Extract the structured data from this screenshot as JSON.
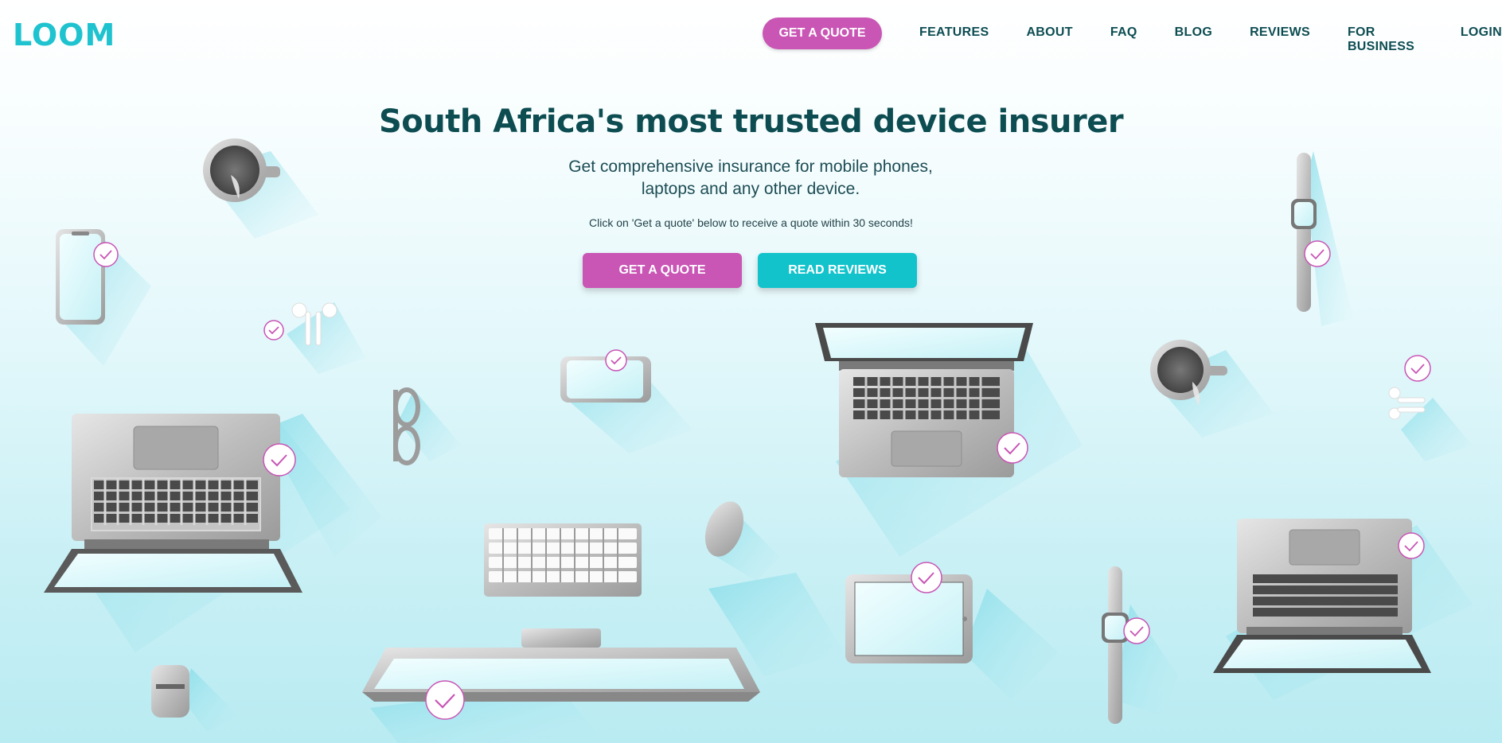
{
  "header": {
    "logo": "LOOM",
    "cta_label": "GET A QUOTE",
    "nav": [
      "FEATURES",
      "ABOUT",
      "FAQ",
      "BLOG",
      "REVIEWS",
      "FOR BUSINESS",
      "LOGIN"
    ]
  },
  "hero": {
    "title": "South Africa's most trusted device insurer",
    "subtitle_line1": "Get comprehensive insurance for mobile phones,",
    "subtitle_line2": "laptops and any other device.",
    "note": "Click on 'Get a quote' below to receive a quote within 30 seconds!",
    "primary_button": "GET A QUOTE",
    "secondary_button": "READ REVIEWS"
  },
  "colors": {
    "brand_teal": "#1fc3cf",
    "brand_magenta": "#c955b5",
    "nav_text": "#0d4d52"
  },
  "icons": [
    "coffee-mug-icon",
    "smartphone-icon",
    "earbuds-icon",
    "smartwatch-icon",
    "laptop-icon",
    "glasses-icon",
    "keyboard-icon",
    "mouse-icon",
    "tablet-icon",
    "monitor-icon",
    "airpods-case-icon",
    "checkmark-icon"
  ]
}
